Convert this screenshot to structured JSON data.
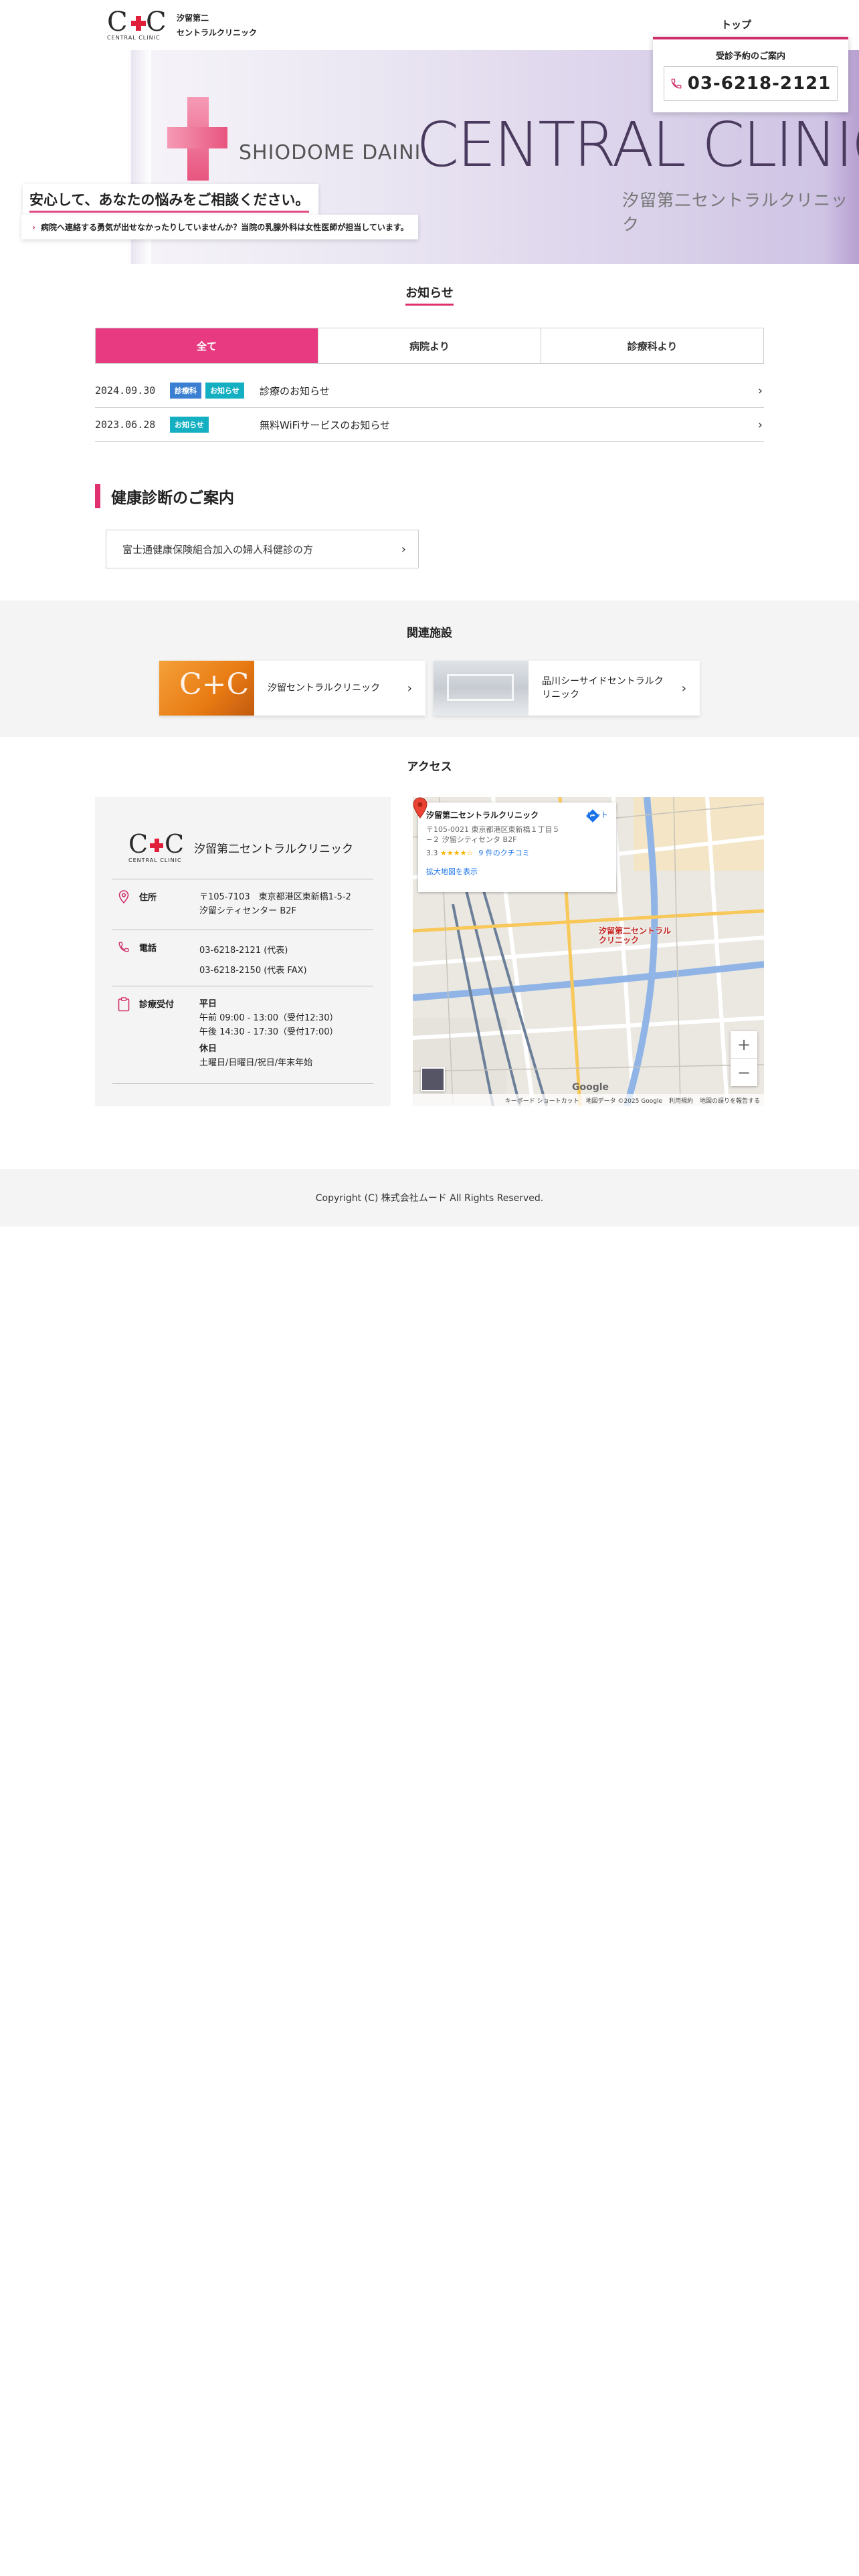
{
  "header": {
    "logo_sub": "CENTRAL CLINIC",
    "logo_name_line1": "汐留第二",
    "logo_name_line2": "セントラルクリニック",
    "nav_top": "トップ"
  },
  "booking": {
    "title": "受診予約のご案内",
    "phone": "03-6218-2121",
    "icon": "phone-icon"
  },
  "hero": {
    "shiodome": "SHIODOME DAINI",
    "central": "CENTRAL CLINIC",
    "jp_name": "汐留第二セントラルクリニック",
    "catch": "安心して、あなたの悩みをご相談ください。",
    "note": "病院へ連絡する勇気が出せなかったりしていませんか？当院の乳腺外科は女性医師が担当しています。"
  },
  "news": {
    "title": "お知らせ",
    "tabs": [
      {
        "label": "全て",
        "active": true
      },
      {
        "label": "病院より",
        "active": false
      },
      {
        "label": "診療科より",
        "active": false
      }
    ],
    "items": [
      {
        "date": "2024.09.30",
        "badges": [
          {
            "label": "診療科",
            "color": "#3a7fd2"
          },
          {
            "label": "お知らせ",
            "color": "#14b0c2"
          }
        ],
        "title": "診療のお知らせ"
      },
      {
        "date": "2023.06.28",
        "badges": [
          {
            "label": "お知らせ",
            "color": "#14b0c2"
          }
        ],
        "title": "無料WiFiサービスのお知らせ"
      }
    ]
  },
  "kenshin": {
    "title": "健康診断のご案内",
    "link": "富士通健康保険組合加入の婦人科健診の方"
  },
  "related": {
    "title": "関連施設",
    "items": [
      {
        "name": "汐留セントラルクリニック"
      },
      {
        "name": "品川シーサイドセントラルクリニック"
      }
    ]
  },
  "access": {
    "title": "アクセス",
    "clinic_name": "汐留第二セントラルクリニック",
    "address_label": "住所",
    "address_line1": "〒105-7103　東京都港区東新橋1-5-2",
    "address_line2": "汐留シティセンター B2F",
    "phone_label": "電話",
    "phone_main": "03-6218-2121 (代表)",
    "phone_fax": "03-6218-2150 (代表 FAX)",
    "hours_label": "診療受付",
    "weekday_label": "平日",
    "weekday_am": "午前 09:00 - 13:00（受付12:30）",
    "weekday_pm": "午後 14:30 - 17:30（受付17:00）",
    "holiday_label": "休日",
    "holiday_value": "土曜日/日曜日/祝日/年末年始"
  },
  "map": {
    "card_name": "汐留第二セントラルクリニック",
    "card_addr": "〒105-0021 東京都港区東新橋１丁目５−２ 汐留シティセンタ B2F",
    "rating": "3.3",
    "stars": "★★★★☆",
    "reviews": "9 件のクチコミ",
    "larger_map": "拡大地図を表示",
    "route": "ルート",
    "pin_label": "汐留第二セントラル クリニック",
    "zoom_in": "+",
    "zoom_out": "−",
    "google": "Google",
    "foot_shortcuts": "キーボード ショートカット",
    "foot_mapdata": "地図データ ©2025 Google",
    "foot_terms": "利用規約",
    "foot_report": "地図の誤りを報告する"
  },
  "footer": {
    "copyright": "Copyright (C) 株式会社ムード All Rights Reserved."
  }
}
